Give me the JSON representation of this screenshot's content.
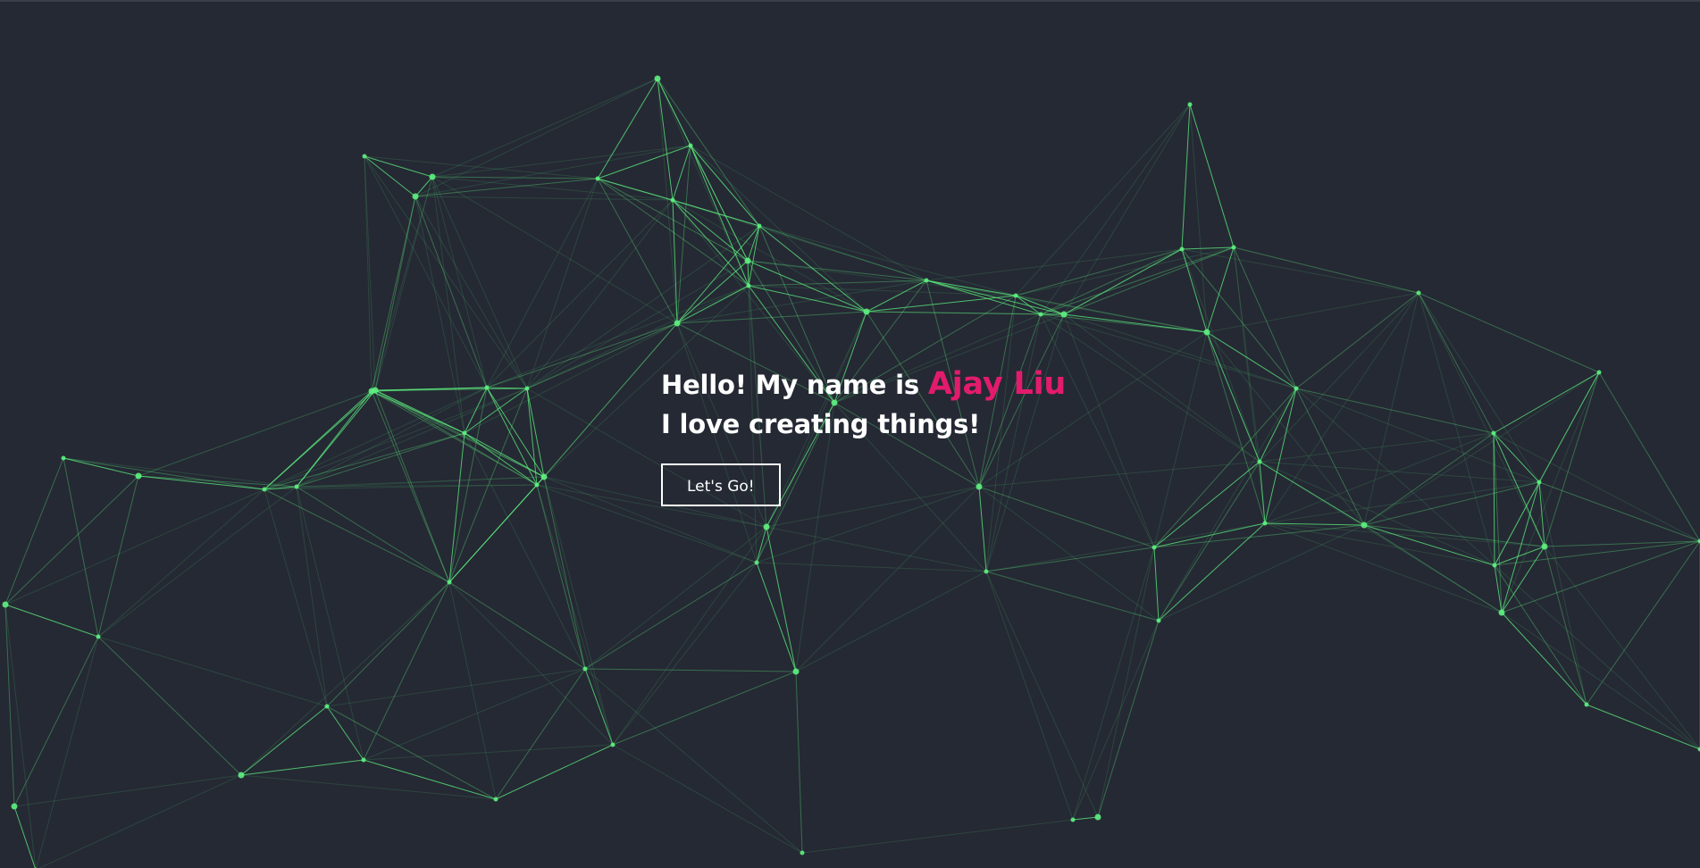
{
  "hero": {
    "greeting": "Hello! My name is",
    "name": "Ajay Liu",
    "tagline": "I love creating things!",
    "cta_label": "Let's Go!"
  },
  "colors": {
    "background": "#252934",
    "accent": "#e31b6d",
    "network": "#5ef07f",
    "text": "#ffffff"
  }
}
